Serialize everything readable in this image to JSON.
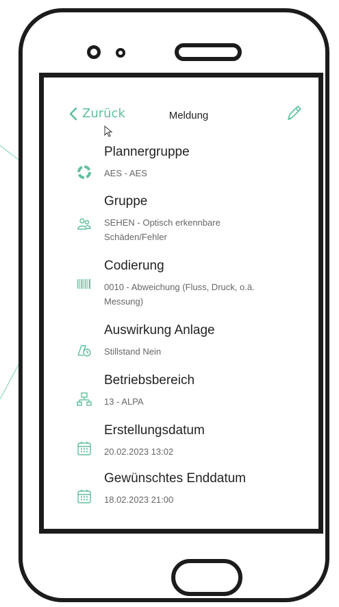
{
  "navbar": {
    "back_label": "Zurück",
    "title": "Meldung"
  },
  "items": [
    {
      "label": "Plannergruppe",
      "value": "AES - AES",
      "icon": "circle-dashed-icon"
    },
    {
      "label": "Gruppe",
      "value": "SEHEN - Optisch erkennbare Schäden/Fehler",
      "icon": "group-icon"
    },
    {
      "label": "Codierung",
      "value": "0010 - Abweichung (Fluss, Druck, o.ä. Messung)",
      "icon": "barcode-icon"
    },
    {
      "label": "Auswirkung Anlage",
      "value": "Stillstand Nein",
      "icon": "impact-icon"
    },
    {
      "label": "Betriebsbereich",
      "value": "13 - ALPA",
      "icon": "hierarchy-icon"
    },
    {
      "label": "Erstellungsdatum",
      "value": "20.02.2023 13:02",
      "icon": "calendar-icon"
    },
    {
      "label": "Gewünschtes Enddatum",
      "value": "18.02.2023 21:00",
      "icon": "calendar-icon"
    }
  ],
  "colors": {
    "accent": "#5fbf9b",
    "frame": "#1c1c1c"
  }
}
